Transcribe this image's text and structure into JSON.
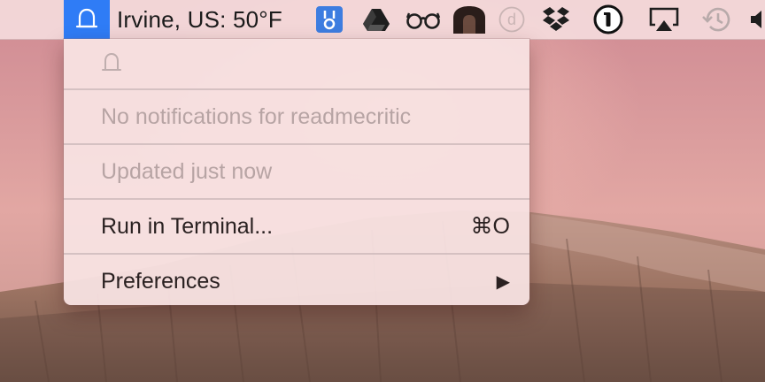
{
  "menubar": {
    "active_app_icon": "bell-icon",
    "weather_text": "Irvine, US: 50°F",
    "status_icons": [
      "keyring-icon",
      "google-drive-icon",
      "glasses-icon",
      "tunnel-icon",
      "d-circle-icon",
      "dropbox-icon",
      "1password-icon",
      "airplay-icon",
      "time-machine-icon"
    ]
  },
  "menu": {
    "header_icon": "bell-outline-icon",
    "items": [
      {
        "label": "No notifications for readmecritic",
        "enabled": false
      },
      {
        "label": "Updated just now",
        "enabled": false
      },
      {
        "label": "Run in Terminal...",
        "shortcut": "⌘O",
        "enabled": true
      },
      {
        "label": "Preferences",
        "submenu_indicator": "▶",
        "enabled": true
      }
    ]
  },
  "colors": {
    "menubar_active": "#2f7cf6",
    "menu_background": "#f8e2e2",
    "disabled_text": "#b7a4a4",
    "enabled_text": "#2a2121"
  }
}
